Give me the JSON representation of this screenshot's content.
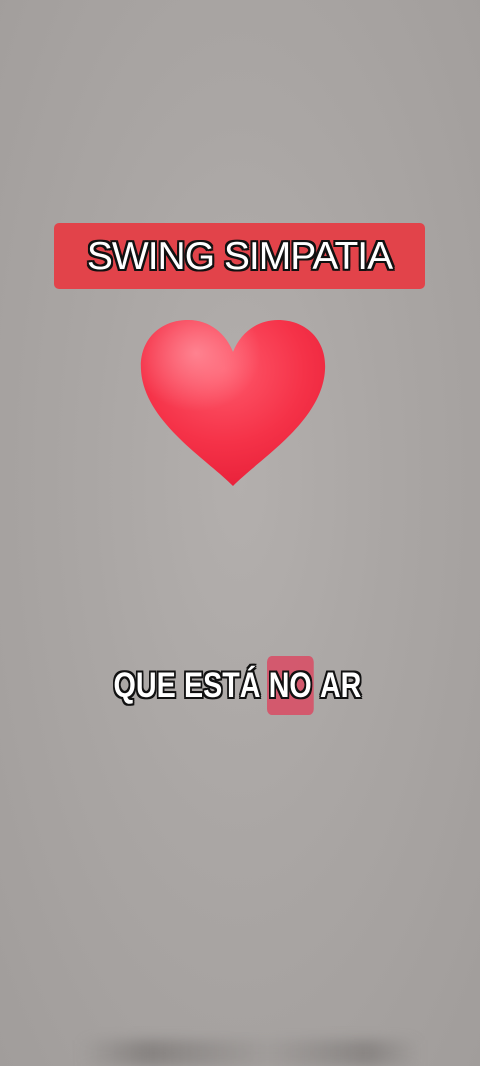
{
  "title_banner": {
    "text": "SWING SIMPATIA",
    "background_color": "#e2434a"
  },
  "heart": {
    "icon": "red-heart-emoji",
    "color": "#f2304a"
  },
  "caption": {
    "words": [
      "QUE",
      "ESTÁ",
      "NO",
      "AR"
    ],
    "highlighted_word": "NO",
    "highlight_color": "#d84d65"
  }
}
